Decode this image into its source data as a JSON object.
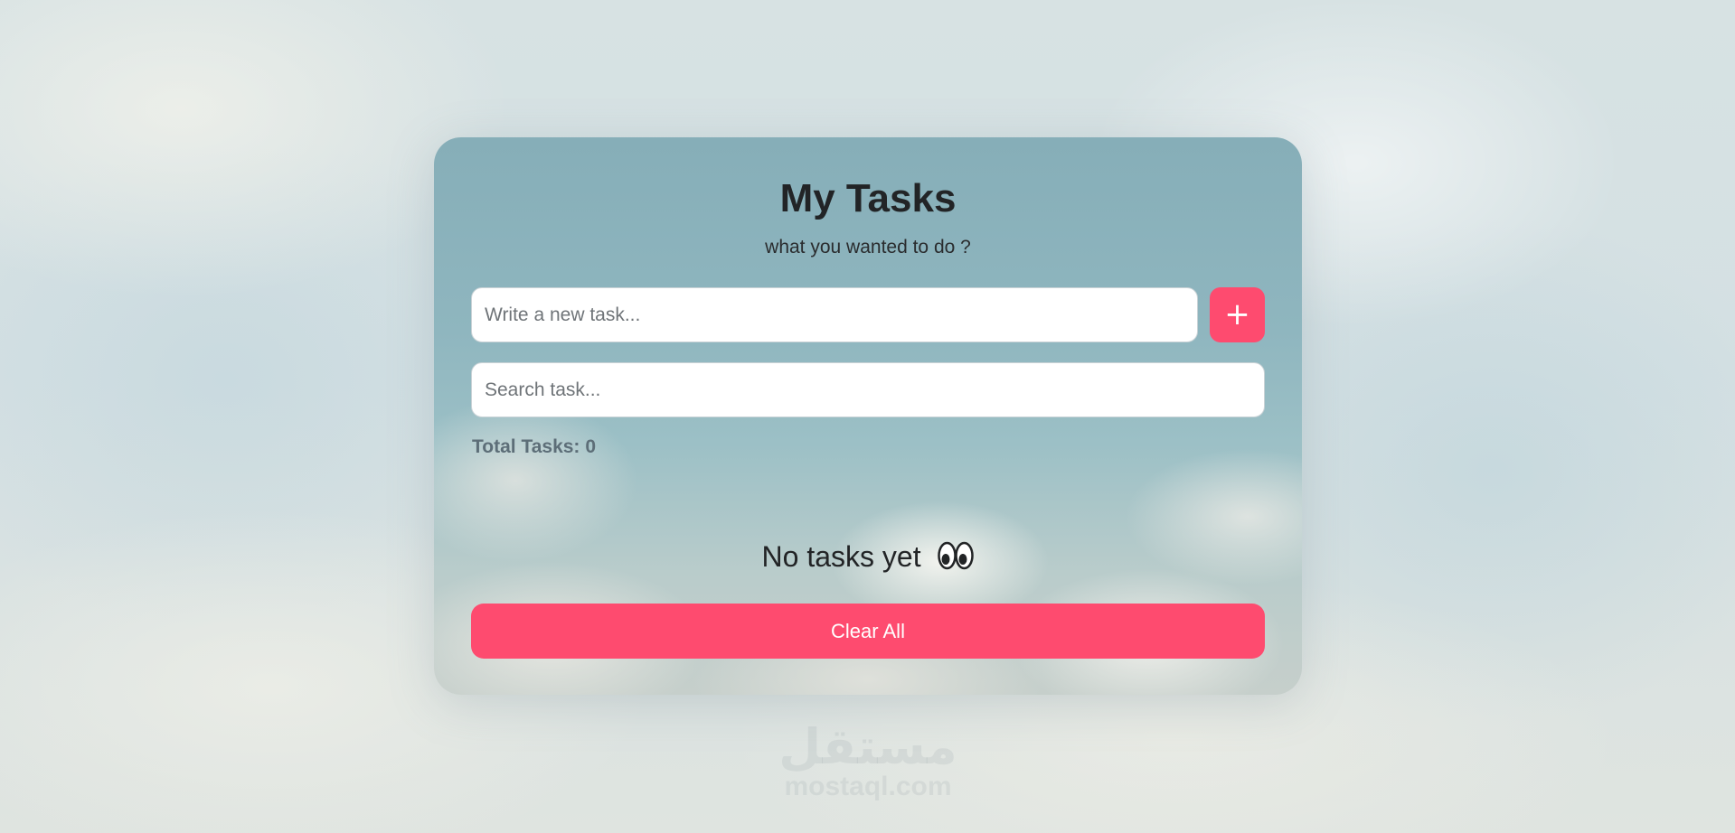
{
  "app": {
    "title": "My Tasks",
    "subtitle": "what you wanted to do ?"
  },
  "new_task": {
    "value": "",
    "placeholder": "Write a new task...",
    "add_label": "+",
    "add_icon": "plus-icon"
  },
  "search": {
    "value": "",
    "placeholder": "Search task..."
  },
  "stats": {
    "total_label": "Total Tasks:",
    "total_count": "0"
  },
  "empty_state": {
    "message": "No tasks yet",
    "icon": "eyes-icon"
  },
  "actions": {
    "clear_all_label": "Clear All"
  },
  "watermark": {
    "arabic": "مستقل",
    "latin": "mostaql.com"
  },
  "colors": {
    "accent": "#fe4b6f",
    "title_text": "#222426",
    "stats_text": "#5d6e78"
  }
}
